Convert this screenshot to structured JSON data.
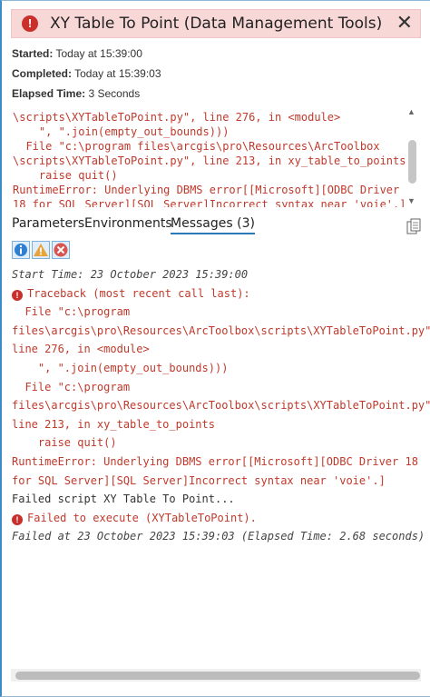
{
  "dialog": {
    "title": "XY Table To Point (Data Management Tools)",
    "close_glyph": "✕",
    "status_glyph": "!"
  },
  "info": {
    "started_label": "Started:",
    "started_value": "Today at 15:39:00",
    "completed_label": "Completed:",
    "completed_value": "Today at 15:39:03",
    "elapsed_label": "Elapsed Time:",
    "elapsed_value": "3 Seconds"
  },
  "log_preview": {
    "lines": [
      "\\scripts\\XYTableToPoint.py\", line 276, in <module>",
      "    \", \".join(empty_out_bounds)))",
      "  File \"c:\\program files\\arcgis\\pro\\Resources\\ArcToolbox",
      "\\scripts\\XYTableToPoint.py\", line 213, in xy_table_to_points",
      "    raise quit()",
      "RuntimeError: Underlying DBMS error[[Microsoft][ODBC Driver",
      "18 for SQL Server][SQL Server]Incorrect syntax near 'voie'.]"
    ]
  },
  "tabs": [
    {
      "label": "Parameters"
    },
    {
      "label": "Environments"
    },
    {
      "label": "Messages (3)"
    }
  ],
  "filters": {
    "info_icon": "info-filter-icon",
    "warning_icon": "warning-filter-icon",
    "error_icon": "error-filter-icon"
  },
  "messages": {
    "start_time": "Start Time: 23 October 2023 15:39:00",
    "traceback_title": "Traceback (most recent call last):",
    "traceback_lines": [
      "  File \"c:\\program",
      "files\\arcgis\\pro\\Resources\\ArcToolbox\\scripts\\XYTableToPoint.py\",",
      "line 276, in <module>",
      "    \", \".join(empty_out_bounds)))",
      "  File \"c:\\program",
      "files\\arcgis\\pro\\Resources\\ArcToolbox\\scripts\\XYTableToPoint.py\",",
      "line 213, in xy_table_to_points",
      "    raise quit()",
      "RuntimeError: Underlying DBMS error[[Microsoft][ODBC Driver 18",
      "for SQL Server][SQL Server]Incorrect syntax near 'voie'.]"
    ],
    "failed_script": "Failed script XY Table To Point...",
    "failed_execute": "Failed to execute (XYTableToPoint).",
    "failed_at": "Failed at 23 October 2023 15:39:03 (Elapsed Time: 2.68 seconds)"
  },
  "colors": {
    "error_red": "#c0392b",
    "header_bg": "#f8d7d7",
    "tab_underline": "#2a7ab8"
  }
}
